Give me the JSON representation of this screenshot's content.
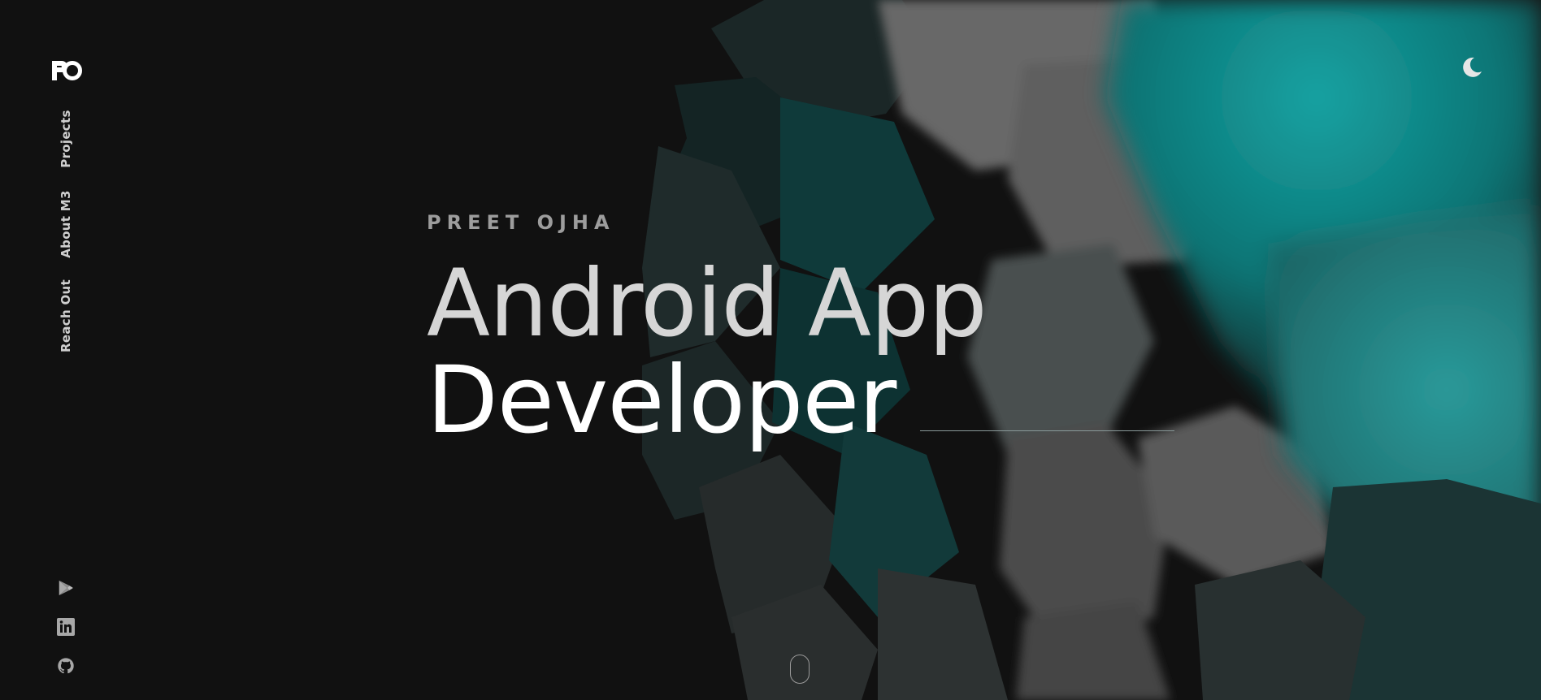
{
  "logo": {
    "text": "PO"
  },
  "nav": {
    "items": [
      {
        "label": "Projects"
      },
      {
        "label": "About M3"
      },
      {
        "label": "Reach Out"
      }
    ]
  },
  "social": [
    {
      "icon": "google-play-icon"
    },
    {
      "icon": "linkedin-icon"
    },
    {
      "icon": "github-icon"
    }
  ],
  "theme_toggle": {
    "icon": "moon-icon"
  },
  "hero": {
    "eyebrow": "PREET OJHA",
    "headline_line1": "Android App",
    "headline_line2": "Developer"
  },
  "colors": {
    "background": "#111111",
    "accent_teal": "#0f8a8a",
    "text_primary": "#ffffff",
    "text_secondary": "#d6d6d6",
    "text_muted": "#9d9d9d"
  }
}
